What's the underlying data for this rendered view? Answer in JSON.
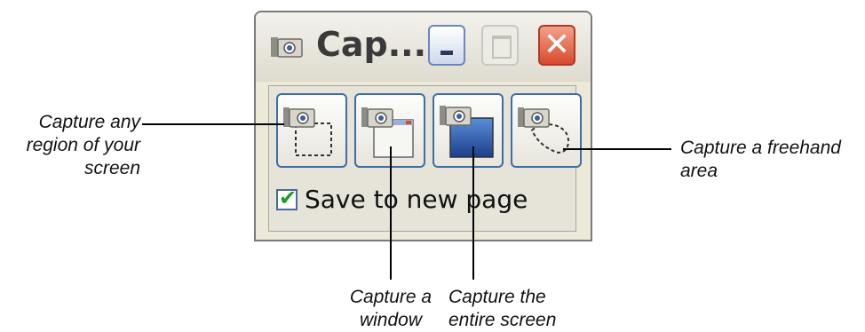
{
  "window": {
    "title": "Cap...",
    "controls": {
      "minimize_icon": "minimize-icon",
      "maximize_icon": "maximize-icon",
      "close_symbol": "✕"
    },
    "capture_buttons": [
      {
        "name": "capture-region-button",
        "icon": "camera-dashed-region-icon"
      },
      {
        "name": "capture-window-button",
        "icon": "camera-window-icon"
      },
      {
        "name": "capture-screen-button",
        "icon": "camera-screen-icon"
      },
      {
        "name": "capture-freehand-button",
        "icon": "camera-freehand-icon"
      }
    ],
    "save_to_new_page": {
      "label": "Save to new page",
      "checked": true,
      "check_symbol": "✔"
    }
  },
  "callouts": {
    "region": [
      "Capture any",
      "region of your",
      "screen"
    ],
    "window": [
      "Capture a",
      "window"
    ],
    "screen": [
      "Capture the",
      "entire screen"
    ],
    "freehand": [
      "Capture a freehand",
      "area"
    ]
  },
  "colors": {
    "window_bg": "#ece9d8",
    "button_border": "#3d6ea6",
    "close_red": "#d84a2c",
    "check_green": "#1e9c22"
  }
}
